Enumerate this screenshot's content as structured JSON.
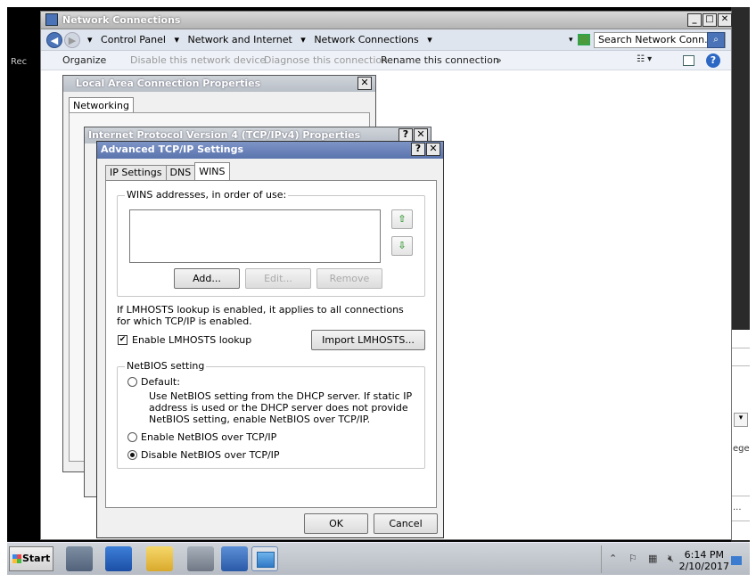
{
  "netwin": {
    "title": "Network Connections",
    "breadcrumbs": [
      "Control Panel",
      "Network and Internet",
      "Network Connections"
    ],
    "search_placeholder": "Search Network Conn...",
    "commands": [
      "Organize",
      "Disable this network device",
      "Diagnose this connection",
      "Rename this connection",
      "»"
    ],
    "left_stub": "Rec"
  },
  "lac": {
    "title": "Local Area Connection Properties",
    "tab": "Networking"
  },
  "ipv4": {
    "title": "Internet Protocol Version 4 (TCP/IPv4) Properties"
  },
  "adv": {
    "title": "Advanced TCP/IP Settings",
    "tabs": [
      "IP Settings",
      "DNS",
      "WINS"
    ],
    "active_tab": "WINS",
    "wins_group": "WINS addresses, in order of use:",
    "add": "Add...",
    "edit": "Edit...",
    "remove": "Remove",
    "lmhosts_note": "If LMHOSTS lookup is enabled, it applies to all connections for which TCP/IP is enabled.",
    "enable_lmhosts": "Enable LMHOSTS lookup",
    "enable_lmhosts_checked": true,
    "import_lmhosts": "Import LMHOSTS...",
    "netbios_group": "NetBIOS setting",
    "opt_default": "Default:",
    "opt_default_desc": "Use NetBIOS setting from the DHCP server. If static IP address is used or the DHCP server does not provide NetBIOS setting, enable NetBIOS over TCP/IP.",
    "opt_enable": "Enable NetBIOS over TCP/IP",
    "opt_disable": "Disable NetBIOS over TCP/IP",
    "selected_option": "Disable NetBIOS over TCP/IP",
    "ok": "OK",
    "cancel": "Cancel"
  },
  "right_strip": {
    "text": "ege",
    "dots": "..."
  },
  "taskbar": {
    "start": "Start",
    "time": "6:14 PM",
    "date": "2/10/2017"
  }
}
